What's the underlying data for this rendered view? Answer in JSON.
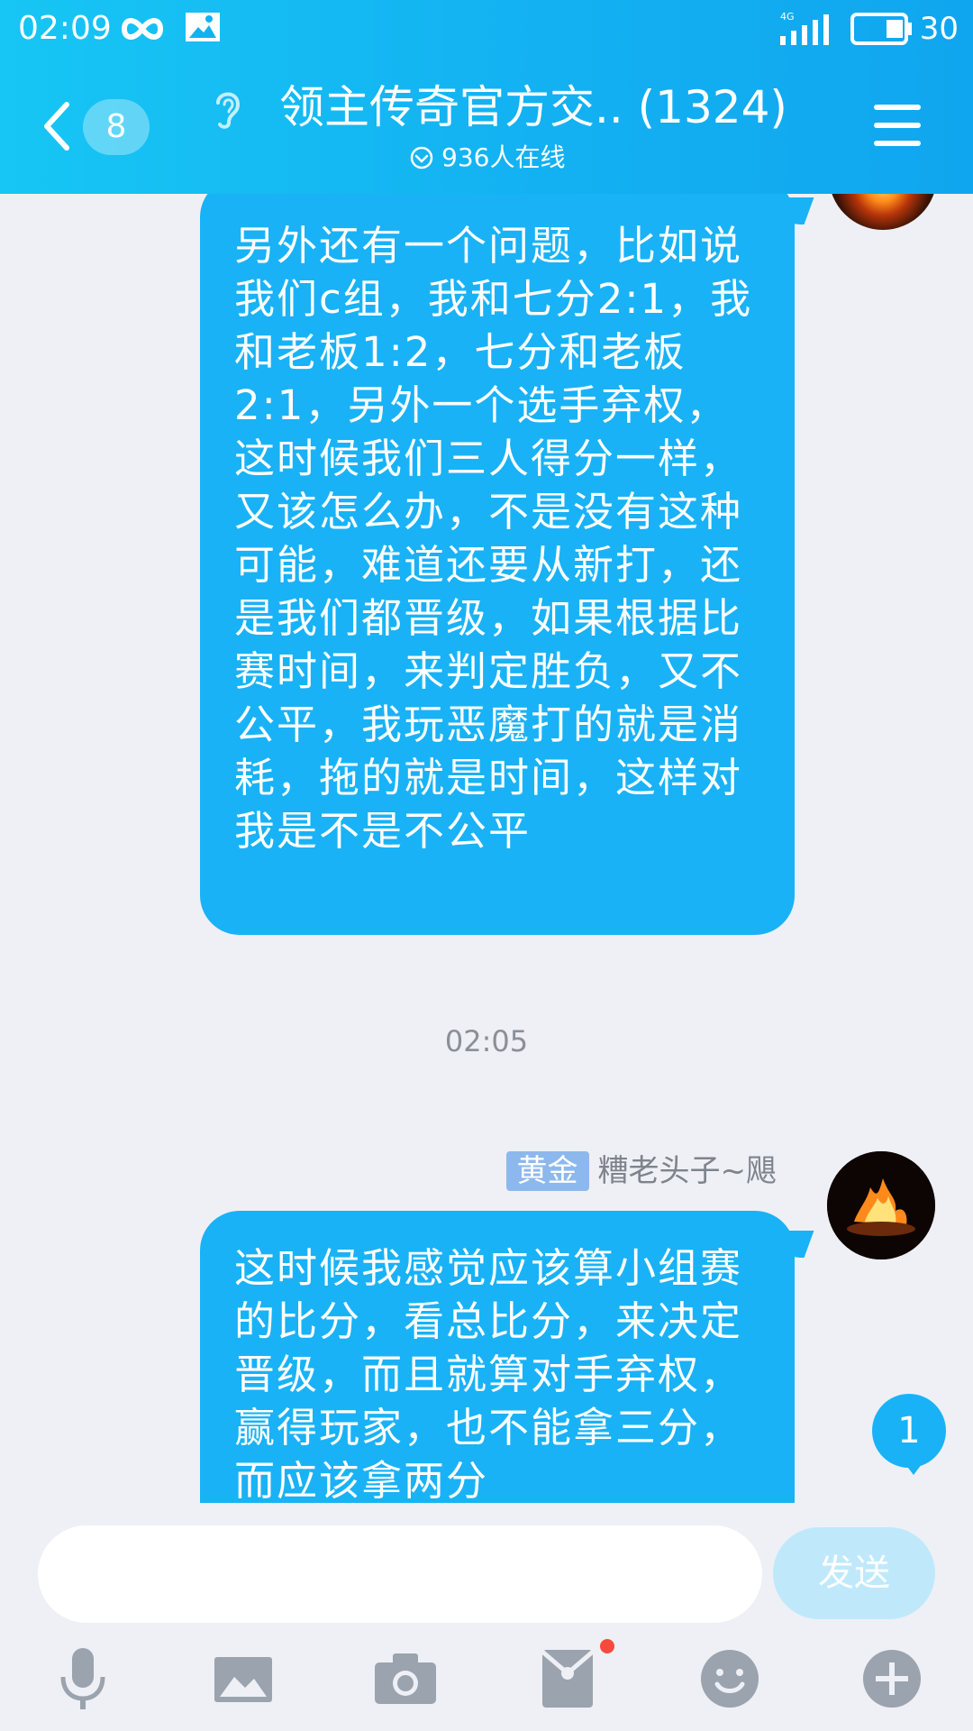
{
  "status_bar": {
    "time": "02:09",
    "battery_level": "30",
    "network": "4G",
    "icons": [
      "infinity-icon",
      "gallery-notification-icon",
      "signal-icon",
      "battery-icon"
    ]
  },
  "header": {
    "back_badge": "8",
    "title": "领主传奇官方交.. (1324)",
    "online_text": "936人在线",
    "icons": [
      "back-chevron-icon",
      "ear-icon",
      "online-check-icon",
      "menu-icon"
    ]
  },
  "messages": [
    {
      "text": "另外还有一个问题，比如说我们c组，我和七分2:1，我和老板1:2，七分和老板2:1，另外一个选手弃权，这时候我们三人得分一样，又该怎么办，不是没有这种可能，难道还要从新打，还是我们都晋级，如果根据比赛时间，来判定胜负，又不公平，我玩恶魔打的就是消耗，拖的就是时间，这样对我是不是不公平"
    },
    {
      "timestamp": "02:05",
      "level_tag": "黄金",
      "sender": "糟老头子~飓",
      "text": "这时候我感觉应该算小组赛的比分，看总比分，来决定晋级，而且就算对手弃权，赢得玩家，也不能拿三分，而应该拿两分"
    }
  ],
  "unread_count": "1",
  "composer": {
    "input_value": "",
    "send_label": "发送"
  },
  "toolbar": [
    "microphone-icon",
    "image-icon",
    "camera-icon",
    "red-packet-icon",
    "emoji-icon",
    "plus-icon"
  ],
  "colors": {
    "header": "#13b1f2",
    "bubble": "#19b2f6",
    "background": "#eef0f6",
    "send_disabled": "#bfe9fb",
    "badge_red": "#f54a3c"
  }
}
